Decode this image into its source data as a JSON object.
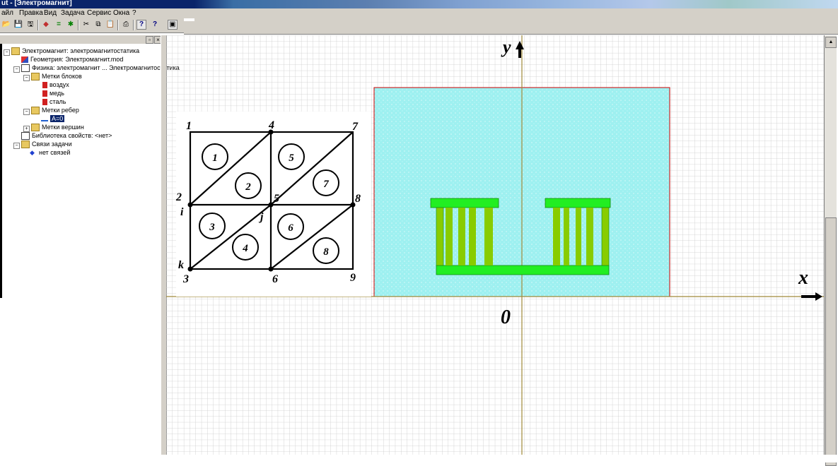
{
  "window": {
    "title": "ut - [Электромагнит]"
  },
  "menu": [
    {
      "label": "айл"
    },
    {
      "label": "Правка"
    },
    {
      "label": "Вид"
    },
    {
      "label": "Задача"
    },
    {
      "label": "Сервис"
    },
    {
      "label": "Окна"
    },
    {
      "label": "?"
    }
  ],
  "toolbar": {
    "buttons": [
      {
        "icon": "open-folder-icon",
        "glyph": "📂"
      },
      {
        "icon": "save-icon",
        "glyph": "💾"
      },
      {
        "icon": "save-all-icon",
        "glyph": "🖫"
      },
      {
        "icon": "shapes-icon",
        "glyph": "◆"
      },
      {
        "icon": "equals-icon",
        "glyph": "="
      },
      {
        "icon": "gear-icon",
        "glyph": "✱"
      },
      {
        "icon": "cut-icon",
        "glyph": "✂"
      },
      {
        "icon": "copy-icon",
        "glyph": "⧉"
      },
      {
        "icon": "paste-icon",
        "glyph": "📋"
      },
      {
        "icon": "print-icon",
        "glyph": "⎙"
      },
      {
        "icon": "help-icon",
        "glyph": "?"
      },
      {
        "icon": "context-help-icon",
        "glyph": "?"
      },
      {
        "icon": "window-icon",
        "glyph": "▣"
      }
    ]
  },
  "tree": {
    "items": [
      {
        "label": "Электромагнит: электромагнитостатика",
        "indent": 0,
        "icon": "folder"
      },
      {
        "label": "Геометрия: Электромагнит.mod",
        "indent": 1,
        "icon": "geometry"
      },
      {
        "label": "Физика: электромагнит ... Электромагнитостатика",
        "indent": 1,
        "icon": "table"
      },
      {
        "label": "Метки блоков",
        "indent": 2,
        "icon": "folder"
      },
      {
        "label": "воздух",
        "indent": 3,
        "icon": "red"
      },
      {
        "label": "медь",
        "indent": 3,
        "icon": "red"
      },
      {
        "label": "сталь",
        "indent": 3,
        "icon": "red"
      },
      {
        "label": "Метки ребер",
        "indent": 2,
        "icon": "folder"
      },
      {
        "label": "A=0",
        "indent": 3,
        "icon": "edge",
        "selected": true
      },
      {
        "label": "Метки вершин",
        "indent": 2,
        "icon": "folder"
      },
      {
        "label": "Библиотека свойств: <нет>",
        "indent": 1,
        "icon": "table"
      },
      {
        "label": "Связи задачи",
        "indent": 1,
        "icon": "folder"
      },
      {
        "label": "нет связей",
        "indent": 2,
        "icon": "link"
      }
    ]
  },
  "mesh_inset": {
    "node_labels": [
      "1",
      "2",
      "3",
      "4",
      "5",
      "6",
      "7",
      "8",
      "9"
    ],
    "element_labels": [
      "1",
      "2",
      "3",
      "4",
      "5",
      "6",
      "7",
      "8"
    ],
    "local_labels": {
      "i": "i",
      "j": "j",
      "k": "k"
    }
  },
  "axes": {
    "x_label": "x",
    "y_label": "y",
    "origin_label": "0"
  },
  "colors": {
    "air": "#a8f4f4",
    "steel": "#22ee22",
    "copper": "#88cc00",
    "border": "#cc0000",
    "axis": "#a08a3a",
    "grid": "#cccccc"
  }
}
